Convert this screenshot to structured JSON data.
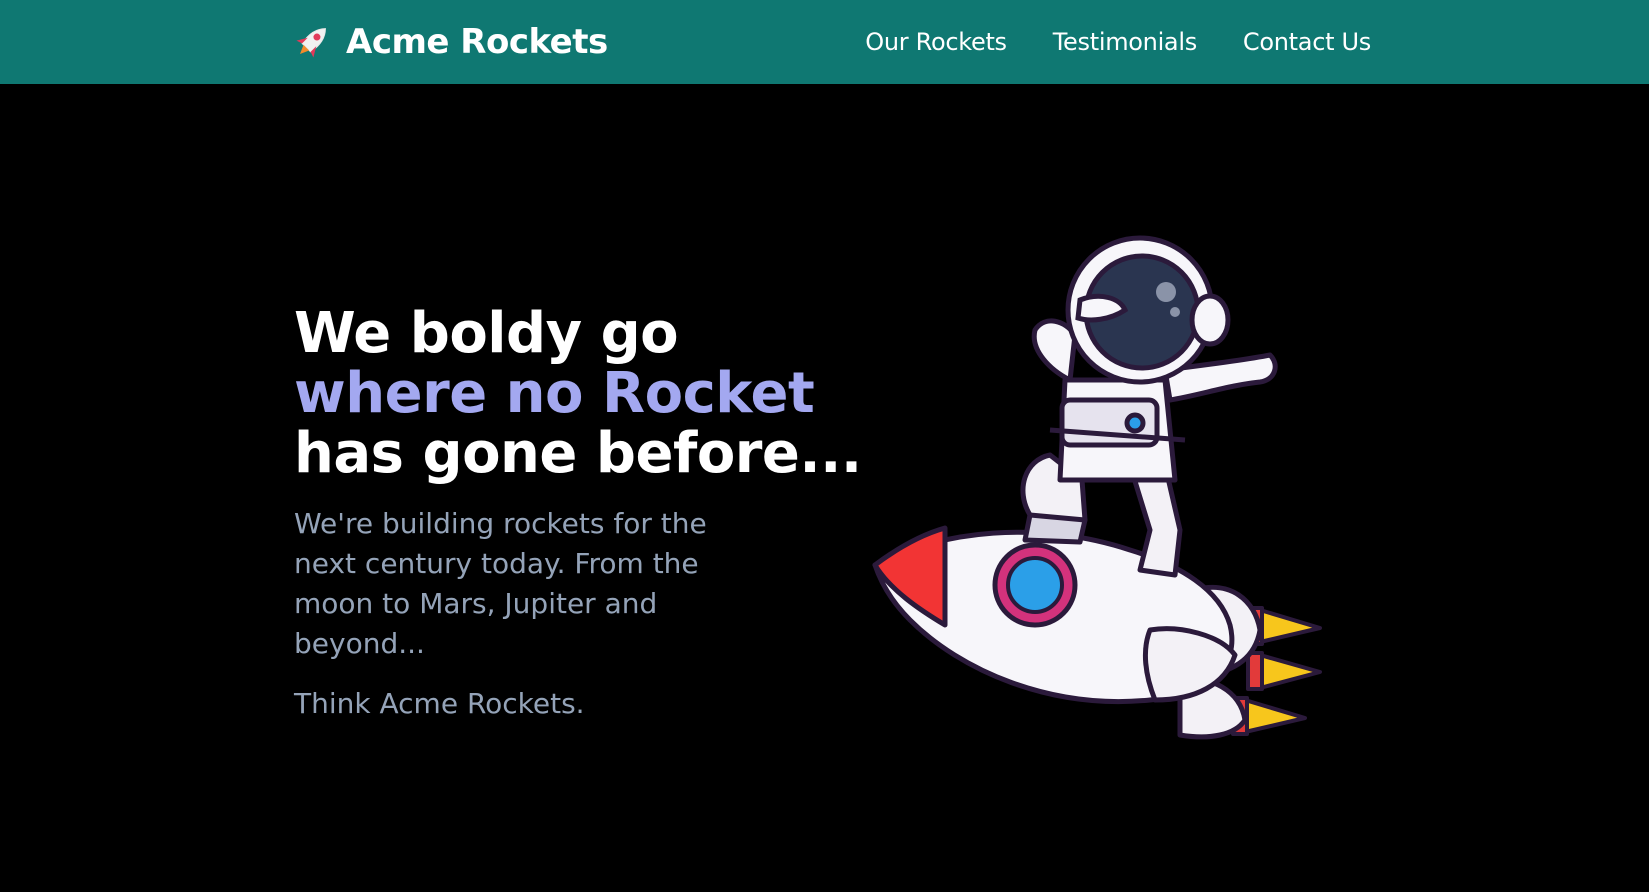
{
  "header": {
    "brand_name": "Acme Rockets",
    "brand_icon": "rocket-icon",
    "background_color": "#0f7872",
    "nav": [
      {
        "label": "Our Rockets"
      },
      {
        "label": "Testimonials"
      },
      {
        "label": "Contact Us"
      }
    ]
  },
  "hero": {
    "headline_line1": "We boldy go",
    "headline_line2": "where no Rocket",
    "headline_line3": "has gone before...",
    "accent_color": "#a3a8f0",
    "lead": "We're building rockets for the next century today. From the moon to Mars, Jupiter and beyond...",
    "tagline": "Think Acme Rockets.",
    "illustration": "astronaut-on-rocket-illustration"
  }
}
